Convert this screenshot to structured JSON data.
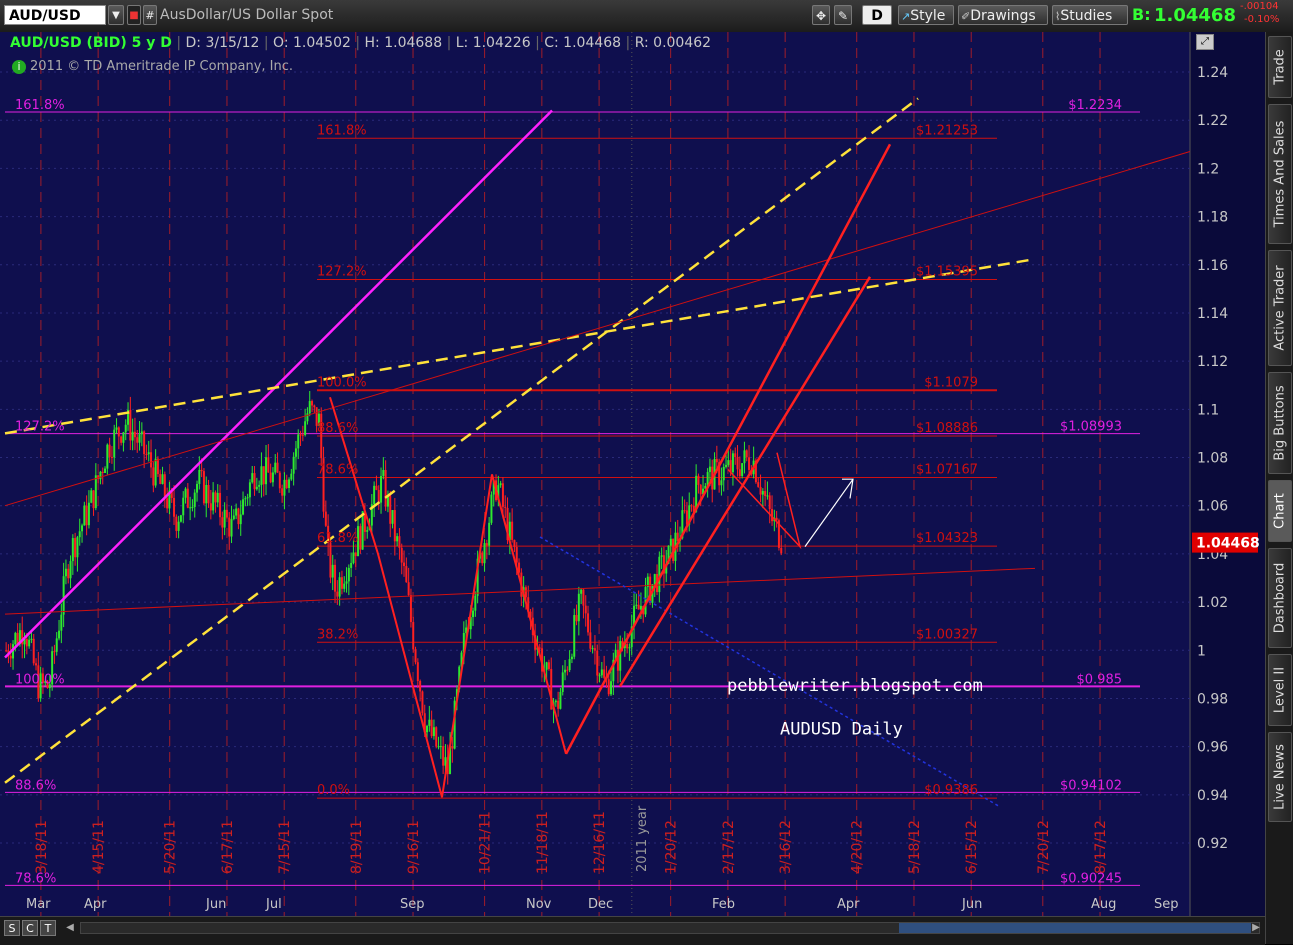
{
  "toolbar": {
    "symbol": "AUD/USD",
    "description": "AusDollar/US Dollar Spot",
    "period_button": "D",
    "style_label": "Style",
    "drawings_label": "Drawings",
    "studies_label": "Studies",
    "bid_label": "B:",
    "bid_value": "1.04468",
    "change_value": "-.00104",
    "change_pct": "-0.10%"
  },
  "chart_header": {
    "title": "AUD/USD (BID) 5 y D",
    "date": "D: 3/15/12",
    "open": "O: 1.04502",
    "high": "H: 1.04688",
    "low": "L: 1.04226",
    "close": "C: 1.04468",
    "range": "R: 0.00462",
    "copyright": "2011 © TD Ameritrade IP Company, Inc."
  },
  "side_tabs": [
    "Trade",
    "Times And Sales",
    "Active Trader",
    "Big Buttons",
    "Chart",
    "Dashboard",
    "Level II",
    "Live News"
  ],
  "active_tab": "Chart",
  "bottom_buttons": [
    "S",
    "C",
    "T"
  ],
  "annotations": {
    "blog": "pebblewriter.blogspot.com",
    "subtitle": "AUDUSD Daily",
    "year_label": "2011 year"
  },
  "chart_data": {
    "type": "candlestick",
    "ylim": [
      0.895,
      1.25
    ],
    "y_ticks": [
      "1.24",
      "1.22",
      "1.2",
      "1.18",
      "1.16",
      "1.14",
      "1.12",
      "1.1",
      "1.08",
      "1.06",
      "1.04",
      "1.02",
      "1",
      "0.98",
      "0.96",
      "0.94",
      "0.92"
    ],
    "x_month_labels": [
      "Mar",
      "Apr",
      "Jun",
      "Jul",
      "Sep",
      "Nov",
      "Dec",
      "Feb",
      "Apr",
      "Jun",
      "Aug",
      "Sep"
    ],
    "date_labels": [
      "3/18/11",
      "4/15/11",
      "5/20/11",
      "6/17/11",
      "7/15/11",
      "8/19/11",
      "9/16/11",
      "10/21/11",
      "11/18/11",
      "12/16/11",
      "1/20/12",
      "2/17/12",
      "3/16/12",
      "4/20/12",
      "5/18/12",
      "6/15/12",
      "7/20/12",
      "8/17/12"
    ],
    "current_price": "1.04468",
    "price_series_approx": [
      [
        "2011-03-01",
        1.0
      ],
      [
        "2011-03-10",
        1.01
      ],
      [
        "2011-03-17",
        0.985
      ],
      [
        "2011-03-22",
        0.985
      ],
      [
        "2011-04-01",
        1.04
      ],
      [
        "2011-04-11",
        1.06
      ],
      [
        "2011-04-20",
        1.085
      ],
      [
        "2011-04-29",
        1.095
      ],
      [
        "2011-05-09",
        1.08
      ],
      [
        "2011-05-23",
        1.055
      ],
      [
        "2011-06-03",
        1.07
      ],
      [
        "2011-06-20",
        1.05
      ],
      [
        "2011-07-01",
        1.075
      ],
      [
        "2011-07-15",
        1.07
      ],
      [
        "2011-07-27",
        1.1
      ],
      [
        "2011-08-01",
        1.095
      ],
      [
        "2011-08-05",
        1.04
      ],
      [
        "2011-08-09",
        1.025
      ],
      [
        "2011-08-22",
        1.05
      ],
      [
        "2011-09-01",
        1.07
      ],
      [
        "2011-09-12",
        1.03
      ],
      [
        "2011-09-22",
        0.97
      ],
      [
        "2011-10-03",
        0.95
      ],
      [
        "2011-10-12",
        1.01
      ],
      [
        "2011-10-27",
        1.07
      ],
      [
        "2011-11-10",
        1.02
      ],
      [
        "2011-11-25",
        0.975
      ],
      [
        "2011-12-07",
        1.02
      ],
      [
        "2011-12-19",
        0.985
      ],
      [
        "2012-01-06",
        1.02
      ],
      [
        "2012-01-20",
        1.04
      ],
      [
        "2012-02-03",
        1.07
      ],
      [
        "2012-02-17",
        1.075
      ],
      [
        "2012-02-29",
        1.08
      ],
      [
        "2012-03-09",
        1.055
      ],
      [
        "2012-03-15",
        1.045
      ]
    ],
    "fib_levels_left": [
      {
        "label": "161.8%",
        "price_label": "$1.2234",
        "value": 1.2234
      },
      {
        "label": "127.2%",
        "price_label": "$1.08993",
        "value": 1.0899
      },
      {
        "label": "100.0%",
        "price_label": "$0.985",
        "value": 0.985
      },
      {
        "label": "88.6%",
        "price_label": "$0.94102",
        "value": 0.941
      },
      {
        "label": "78.6%",
        "price_label": "$0.90245",
        "value": 0.9024
      }
    ],
    "fib_levels_right": [
      {
        "label": "161.8%",
        "price_label": "$1.21253",
        "value": 1.2125
      },
      {
        "label": "127.2%",
        "price_label": "$1.15395",
        "value": 1.1539
      },
      {
        "label": "100.0%",
        "price_label": "$1.1079",
        "value": 1.1079
      },
      {
        "label": "88.6%",
        "price_label": "$1.08886",
        "value": 1.0889
      },
      {
        "label": "78.6%",
        "price_label": "$1.07167",
        "value": 1.0717
      },
      {
        "label": "61.8%",
        "price_label": "$1.04323",
        "value": 1.0432
      },
      {
        "label": "38.2%",
        "price_label": "$1.00327",
        "value": 1.0033
      },
      {
        "label": "0.0%",
        "price_label": "$0.9386",
        "value": 0.9386
      }
    ],
    "colors": {
      "background": "#0f0f4e",
      "up_candle": "#2eea2e",
      "down_candle": "#ff2020",
      "fib_right": "#d01010",
      "fib_left": "#e020e0",
      "trend_yellow": "#ffe23a",
      "date_text": "#cc1f1f",
      "axis_text": "#c8c8c8"
    }
  }
}
